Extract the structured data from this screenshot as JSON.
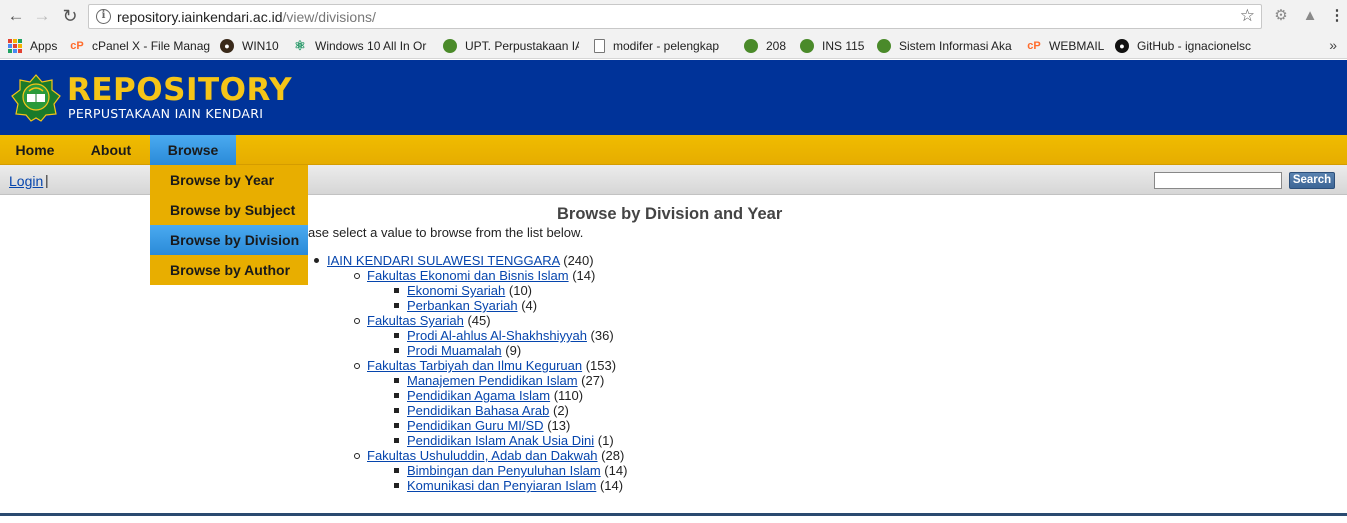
{
  "browser": {
    "url_host": "repository.iainkendari.ac.id",
    "url_path": "/view/divisions/",
    "bookmarks": [
      {
        "label": "Apps",
        "icon": "apps-grid-icon"
      },
      {
        "label": "cPanel X - File Manag",
        "icon": "cpanel-icon"
      },
      {
        "label": "WIN10",
        "icon": "win10-icon"
      },
      {
        "label": "Windows 10 All In Or",
        "icon": "atom-icon"
      },
      {
        "label": "UPT. Perpustakaan IA",
        "icon": "iain-logo-icon"
      },
      {
        "label": "modifer - pelengkap",
        "icon": "document-icon"
      },
      {
        "label": "208",
        "icon": "iain-logo-icon"
      },
      {
        "label": "INS 115",
        "icon": "iain-logo-icon"
      },
      {
        "label": "Sistem Informasi Aka",
        "icon": "iain-logo-icon"
      },
      {
        "label": "WEBMAIL",
        "icon": "cpanel-icon"
      },
      {
        "label": "GitHub - ignacionelsc",
        "icon": "github-icon"
      }
    ],
    "more": "»"
  },
  "site": {
    "title": "REPOSITORY",
    "subtitle": "PERPUSTAKAAN IAIN KENDARI"
  },
  "menu": [
    {
      "label": "Home"
    },
    {
      "label": "About"
    },
    {
      "label": "Browse"
    }
  ],
  "login": {
    "label": "Login",
    "sep": "|"
  },
  "search": {
    "button": "Search",
    "value": ""
  },
  "dropdown": [
    {
      "label": "Browse by Year"
    },
    {
      "label": "Browse by Subject"
    },
    {
      "label": "Browse by Division"
    },
    {
      "label": "Browse by Author"
    }
  ],
  "page": {
    "title": "Browse by Division and Year",
    "intro": "ase select a value to browse from the list below."
  },
  "tree": [
    {
      "level": 0,
      "label": "IAIN KENDARI SULAWESI TENGGARA",
      "count": "(240)"
    },
    {
      "level": 1,
      "label": "Fakultas Ekonomi dan Bisnis Islam",
      "count": "(14)"
    },
    {
      "level": 2,
      "label": "Ekonomi Syariah",
      "count": "(10)"
    },
    {
      "level": 2,
      "label": "Perbankan Syariah",
      "count": "(4)"
    },
    {
      "level": 1,
      "label": "Fakultas Syariah",
      "count": "(45)"
    },
    {
      "level": 2,
      "label": "Prodi Al-ahlus Al-Shakhshiyyah",
      "count": "(36)"
    },
    {
      "level": 2,
      "label": "Prodi Muamalah",
      "count": "(9)"
    },
    {
      "level": 1,
      "label": "Fakultas Tarbiyah dan Ilmu Keguruan",
      "count": "(153)"
    },
    {
      "level": 2,
      "label": "Manajemen Pendidikan Islam",
      "count": "(27)"
    },
    {
      "level": 2,
      "label": "Pendidikan Agama Islam",
      "count": "(110)"
    },
    {
      "level": 2,
      "label": "Pendidikan Bahasa Arab",
      "count": "(2)"
    },
    {
      "level": 2,
      "label": "Pendidikan Guru MI/SD",
      "count": "(13)"
    },
    {
      "level": 2,
      "label": "Pendidikan Islam Anak Usia Dini",
      "count": "(1)"
    },
    {
      "level": 1,
      "label": "Fakultas Ushuluddin, Adab dan Dakwah",
      "count": "(28)"
    },
    {
      "level": 2,
      "label": "Bimbingan dan Penyuluhan Islam",
      "count": "(14)"
    },
    {
      "level": 2,
      "label": "Komunikasi dan Penyiaran Islam",
      "count": "(14)"
    }
  ],
  "colors": {
    "header_blue": "#003399",
    "menu_gold": "#f0bc00",
    "active_blue": "#2a8ad8",
    "title_gold": "#f5c518",
    "link": "#0645ad"
  }
}
